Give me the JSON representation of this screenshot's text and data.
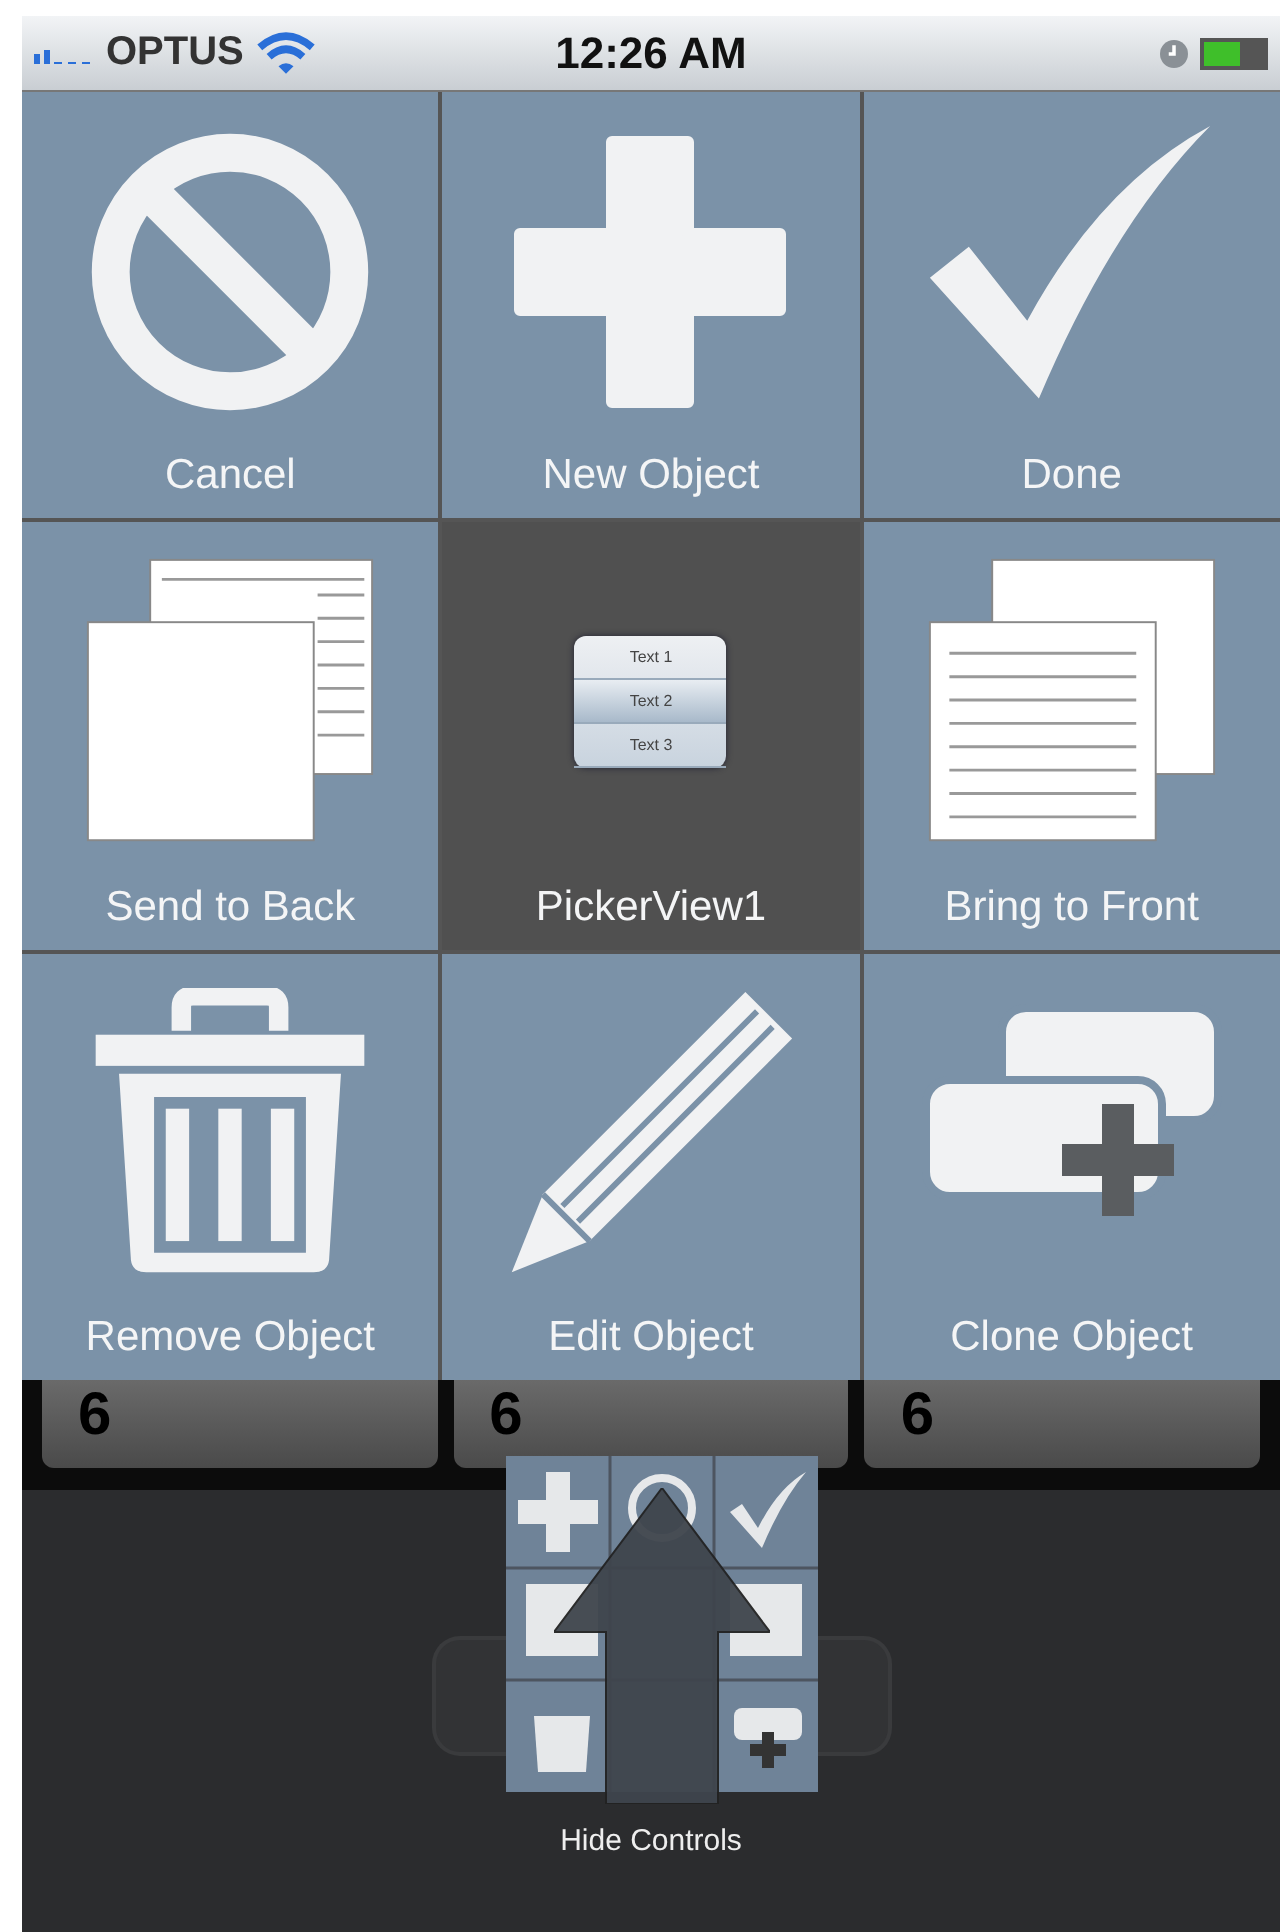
{
  "status_bar": {
    "carrier": "OPTUS",
    "time": "12:26 AM"
  },
  "tiles": [
    {
      "kind": "cancel",
      "label": "Cancel",
      "selected": false
    },
    {
      "kind": "plus",
      "label": "New Object",
      "selected": false
    },
    {
      "kind": "check",
      "label": "Done",
      "selected": false
    },
    {
      "kind": "send-back",
      "label": "Send to Back",
      "selected": false
    },
    {
      "kind": "picker",
      "label": "PickerView1",
      "selected": true
    },
    {
      "kind": "bring-front",
      "label": "Bring to Front",
      "selected": false
    },
    {
      "kind": "trash",
      "label": "Remove Object",
      "selected": false
    },
    {
      "kind": "pencil",
      "label": "Edit Object",
      "selected": false
    },
    {
      "kind": "clone",
      "label": "Clone Object",
      "selected": false
    }
  ],
  "picker_icon_rows": [
    "Text 1",
    "Text 2",
    "Text 3"
  ],
  "picker": {
    "columns": [
      "6",
      "6",
      "6"
    ]
  },
  "hint": {
    "label": "Hide Controls"
  }
}
